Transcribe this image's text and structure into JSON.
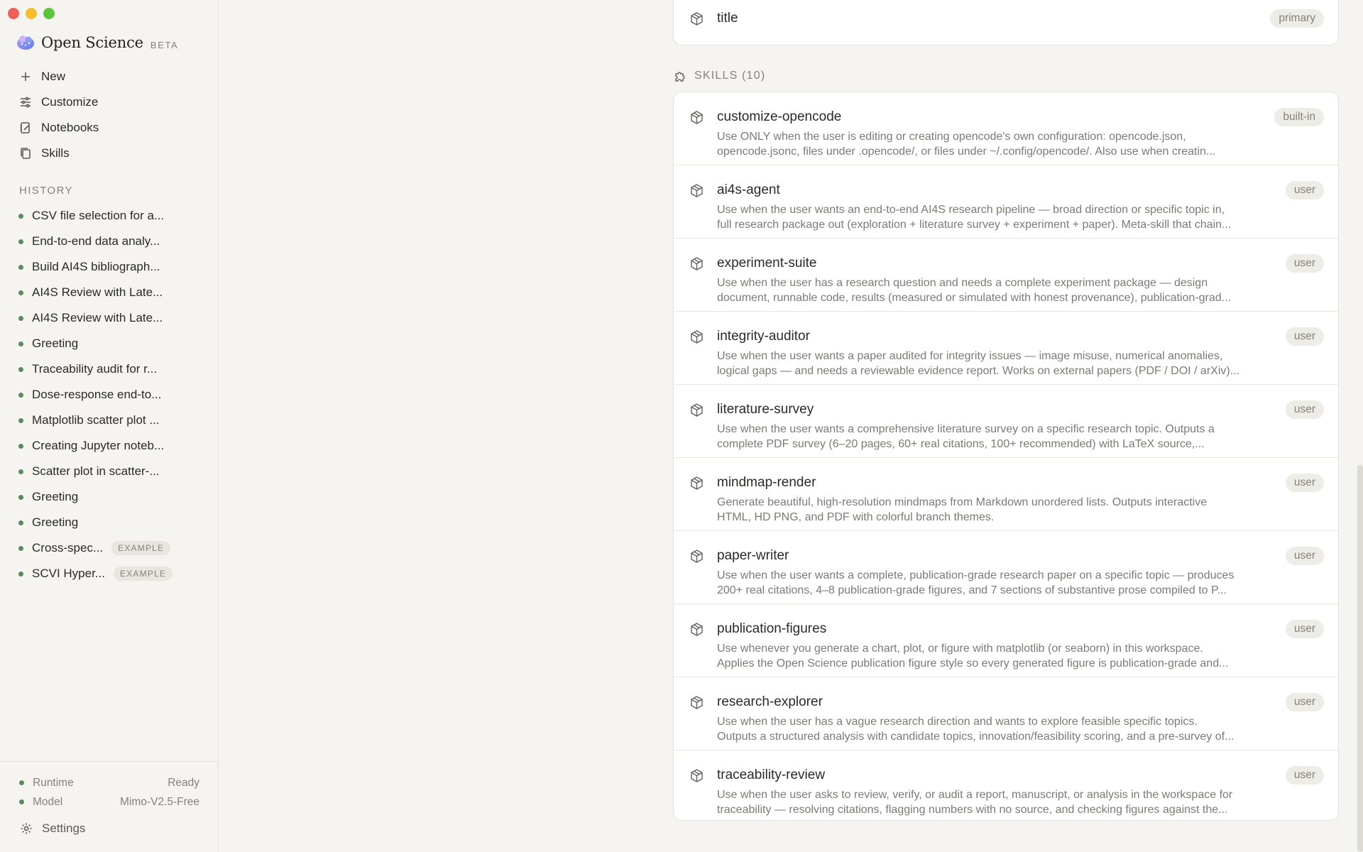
{
  "brand": {
    "name": "Open Science",
    "tag": "BETA"
  },
  "nav": [
    {
      "label": "New",
      "icon": "plus-icon"
    },
    {
      "label": "Customize",
      "icon": "sliders-icon"
    },
    {
      "label": "Notebooks",
      "icon": "notebook-icon"
    },
    {
      "label": "Skills",
      "icon": "copy-icon"
    }
  ],
  "history": {
    "title": "HISTORY",
    "items": [
      {
        "label": "CSV file selection for a..."
      },
      {
        "label": "End-to-end data analy..."
      },
      {
        "label": "Build AI4S bibliograph..."
      },
      {
        "label": "AI4S Review with Late..."
      },
      {
        "label": "AI4S Review with Late..."
      },
      {
        "label": "Greeting"
      },
      {
        "label": "Traceability audit for r..."
      },
      {
        "label": "Dose-response end-to..."
      },
      {
        "label": "Matplotlib scatter plot ..."
      },
      {
        "label": "Creating Jupyter noteb..."
      },
      {
        "label": "Scatter plot in scatter-..."
      },
      {
        "label": "Greeting"
      },
      {
        "label": "Greeting"
      },
      {
        "label": "Cross-spec...",
        "badge": "EXAMPLE"
      },
      {
        "label": "SCVI Hyper...",
        "badge": "EXAMPLE"
      }
    ]
  },
  "footer": {
    "runtime_label": "Runtime",
    "runtime_value": "Ready",
    "model_label": "Model",
    "model_value": "Mimo-V2.5-Free",
    "settings_label": "Settings"
  },
  "title_field": {
    "name": "title",
    "badge": "primary"
  },
  "skills": {
    "header": "SKILLS (10)",
    "items": [
      {
        "name": "customize-opencode",
        "badge": "built-in",
        "line1": "Use ONLY when the user is editing or creating opencode's own configuration: opencode.json,",
        "line2": "opencode.jsonc, files under .opencode/, or files under ~/.config/opencode/. Also use when creatin..."
      },
      {
        "name": "ai4s-agent",
        "badge": "user",
        "line1": "Use when the user wants an end-to-end AI4S research pipeline — broad direction or specific topic in,",
        "line2": "full research package out (exploration + literature survey + experiment + paper). Meta-skill that chain..."
      },
      {
        "name": "experiment-suite",
        "badge": "user",
        "line1": "Use when the user has a research question and needs a complete experiment package — design",
        "line2": "document, runnable code, results (measured or simulated with honest provenance), publication-grad..."
      },
      {
        "name": "integrity-auditor",
        "badge": "user",
        "line1": "Use when the user wants a paper audited for integrity issues — image misuse, numerical anomalies,",
        "line2": "logical gaps — and needs a reviewable evidence report. Works on external papers (PDF / DOI / arXiv)..."
      },
      {
        "name": "literature-survey",
        "badge": "user",
        "line1": "Use when the user wants a comprehensive literature survey on a specific research topic. Outputs a",
        "line2": "complete PDF survey (6–20 pages, 60+ real citations, 100+ recommended) with LaTeX source,..."
      },
      {
        "name": "mindmap-render",
        "badge": "user",
        "line1": "Generate beautiful, high-resolution mindmaps from Markdown unordered lists. Outputs interactive",
        "line2": "HTML, HD PNG, and PDF with colorful branch themes."
      },
      {
        "name": "paper-writer",
        "badge": "user",
        "line1": "Use when the user wants a complete, publication-grade research paper on a specific topic — produces",
        "line2": "200+ real citations, 4–8 publication-grade figures, and 7 sections of substantive prose compiled to P..."
      },
      {
        "name": "publication-figures",
        "badge": "user",
        "line1": "Use whenever you generate a chart, plot, or figure with matplotlib (or seaborn) in this workspace.",
        "line2": "Applies the Open Science publication figure style so every generated figure is publication-grade and..."
      },
      {
        "name": "research-explorer",
        "badge": "user",
        "line1": "Use when the user has a vague research direction and wants to explore feasible specific topics.",
        "line2": "Outputs a structured analysis with candidate topics, innovation/feasibility scoring, and a pre-survey of..."
      },
      {
        "name": "traceability-review",
        "badge": "user",
        "line1": "Use when the user asks to review, verify, or audit a report, manuscript, or analysis in the workspace for",
        "line2": "traceability — resolving citations, flagging numbers with no source, and checking figures against the..."
      }
    ]
  }
}
